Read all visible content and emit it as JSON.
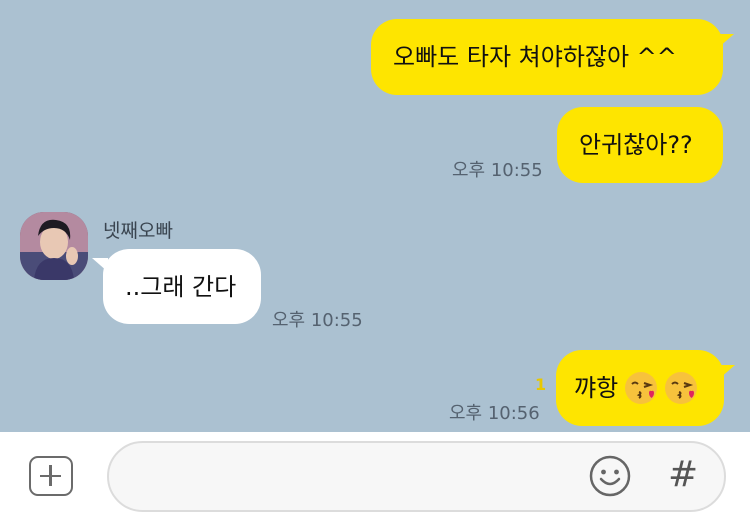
{
  "messages": {
    "m1": {
      "text": "오빠도 타자 쳐야하잖아 ^^"
    },
    "m2": {
      "text": "안귀찮아??",
      "time": "오후 10:55"
    },
    "m3": {
      "sender": "넷째오빠",
      "text": "..그래 간다",
      "time": "오후 10:55"
    },
    "m4": {
      "text": "꺄항",
      "emojis": [
        "kissing-heart-emoji",
        "kissing-heart-emoji"
      ],
      "unread": "1",
      "time": "오후 10:56"
    }
  },
  "input_bar": {
    "add_icon": "plus-square-icon",
    "emoji_icon": "smiley-icon",
    "hash_icon": "#"
  },
  "colors": {
    "background": "#abc1d1",
    "my_bubble": "#fee500",
    "their_bubble": "#ffffff",
    "unread_count": "#e8c800"
  }
}
